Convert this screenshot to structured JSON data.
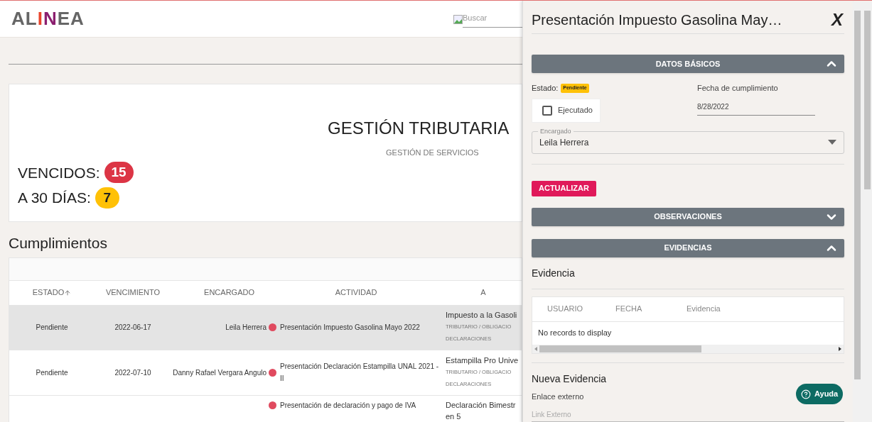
{
  "header": {
    "logo": "ALINEA",
    "search": {
      "placeholder": "Buscar"
    }
  },
  "summary": {
    "title": "GESTIÓN TRIBUTARIA",
    "subtitle": "GESTIÓN DE SERVICIOS",
    "counters": [
      {
        "label": "VENCIDOS:",
        "count": "15",
        "color": "#dc3545"
      },
      {
        "label": "A 30 DÍAS:",
        "count": "7",
        "color": "#ffc107"
      }
    ]
  },
  "section_title": "Cumplimientos",
  "table": {
    "columns": [
      {
        "label": "ESTADO",
        "sorted": true
      },
      {
        "label": "VENCIMIENTO",
        "sorted": false
      },
      {
        "label": "ENCARGADO",
        "sorted": false
      },
      {
        "label": "ACTIVIDAD",
        "sorted": false
      },
      {
        "label": "A",
        "sorted": false
      }
    ],
    "rows": [
      {
        "selected": true,
        "estado": "Pendiente",
        "vencimiento": "2022-06-17",
        "encargado": "Leila Herrera",
        "color": "#e04a5f",
        "actividad": "Presentación Impuesto Gasolina Mayo 2022",
        "column_5": {
          "title": [
            "Impuesto a la Gasoli"
          ],
          "category": [
            "TRIBUTARIO / OBLIGACIO",
            "DECLARACIONES"
          ]
        }
      },
      {
        "selected": false,
        "estado": "Pendiente",
        "vencimiento": "2022-07-10",
        "encargado": "Danny Rafael Vergara Angulo",
        "color": "#e04a5f",
        "actividad": "Presentación Declaración Estampilla UNAL 2021 - II",
        "column_5": {
          "title": [
            "Estampilla Pro Unive"
          ],
          "category": [
            "TRIBUTARIO / OBLIGACIO",
            "DECLARACIONES"
          ]
        }
      },
      {
        "selected": false,
        "color": "#e04a5f",
        "actividad": "Presentación de declaración y pago de IVA",
        "column_5": {
          "title": [
            "Declaración Bimestr",
            "en 5"
          ]
        }
      }
    ]
  },
  "drawer": {
    "title": "Presentación Impuesto Gasolina May…",
    "close_label": "X",
    "datos_basicos": {
      "title": "DATOS BÁSICOS",
      "expanded": true,
      "estado_label": "Estado:",
      "estado_badge": "Pendiente",
      "ejecutado": {
        "label": "Ejecutado",
        "checked": false
      },
      "fecha": {
        "label": "Fecha de cumplimiento",
        "value": "8/28/2022"
      },
      "encargado": {
        "label": "Encargado",
        "value": "Leila Herrera"
      },
      "update_button": "ACTUALIZAR"
    },
    "observaciones": {
      "title": "OBSERVACIONES",
      "expanded": false
    },
    "evidencias": {
      "title": "EVIDENCIAS",
      "expanded": true,
      "heading": "Evidencia",
      "columns": [
        "USUARIO",
        "FECHA",
        "Evidencia"
      ],
      "empty_message": "No records to display",
      "new_heading": "Nueva Evidencia",
      "link_label": "Enlace externo",
      "link_placeholder": "Link Externo"
    }
  },
  "help_button": "Ayuda"
}
